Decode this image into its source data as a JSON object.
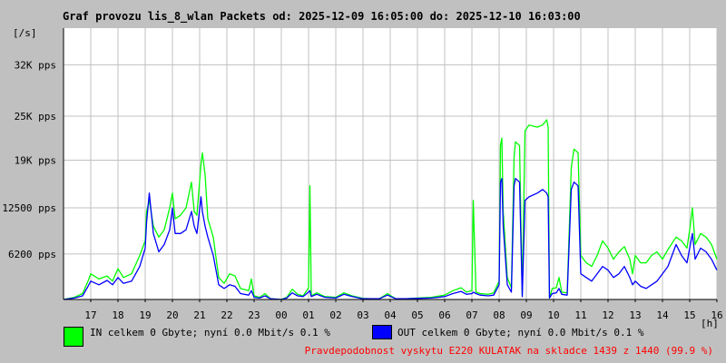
{
  "title": "Graf provozu lis_8_wlan Packets od: 2025-12-09 16:05:00 do: 2025-12-10 16:03:00",
  "colors": {
    "in": "#00ff00",
    "out": "#0000ff",
    "footer": "#ff0000",
    "background": "#c0c0c0",
    "plot": "#ffffff",
    "grid": "#c0c0c0"
  },
  "legend": {
    "in_text": "IN celkem 0 Gbyte; nyní   0.0 Mbit/s 0.1 %",
    "out_text": "OUT celkem 0 Gbyte; nyní   0.0 Mbit/s 0.1 %"
  },
  "footer_text": "Pravdepodobnost vyskytu E220 KULATAK na skladce 1439 z 1440 (99.9 %)",
  "chart_data": {
    "type": "line",
    "title": "Graf provozu lis_8_wlan Packets od: 2025-12-09 16:05:00 do: 2025-12-10 16:03:00",
    "ylabel": "[/s]",
    "xlabel": "[h]",
    "x_unit_note": "hours since 2025-12-09 16:05",
    "ylim": [
      0,
      37000
    ],
    "yticks": [
      {
        "value": 6200,
        "label": "6200 pps"
      },
      {
        "value": 12500,
        "label": "12500 pps"
      },
      {
        "value": 19000,
        "label": "19K pps"
      },
      {
        "value": 25000,
        "label": "25K pps"
      },
      {
        "value": 32000,
        "label": "32K pps"
      }
    ],
    "xticks": [
      {
        "hour": 1,
        "label": "17"
      },
      {
        "hour": 2,
        "label": "18"
      },
      {
        "hour": 3,
        "label": "19"
      },
      {
        "hour": 4,
        "label": "20"
      },
      {
        "hour": 5,
        "label": "21"
      },
      {
        "hour": 6,
        "label": "22"
      },
      {
        "hour": 7,
        "label": "23"
      },
      {
        "hour": 8,
        "label": "00"
      },
      {
        "hour": 9,
        "label": "01"
      },
      {
        "hour": 10,
        "label": "02"
      },
      {
        "hour": 11,
        "label": "03"
      },
      {
        "hour": 12,
        "label": "04"
      },
      {
        "hour": 13,
        "label": "05"
      },
      {
        "hour": 14,
        "label": "06"
      },
      {
        "hour": 15,
        "label": "07"
      },
      {
        "hour": 16,
        "label": "08"
      },
      {
        "hour": 17,
        "label": "09"
      },
      {
        "hour": 18,
        "label": "10"
      },
      {
        "hour": 19,
        "label": "11"
      },
      {
        "hour": 20,
        "label": "12"
      },
      {
        "hour": 21,
        "label": "13"
      },
      {
        "hour": 22,
        "label": "14"
      },
      {
        "hour": 23,
        "label": "15"
      },
      {
        "hour": 24,
        "label": "16"
      }
    ],
    "grid": true,
    "series": [
      {
        "name": "IN",
        "color": "#00ff00",
        "points": [
          [
            0,
            0
          ],
          [
            0.4,
            300
          ],
          [
            0.7,
            800
          ],
          [
            0.9,
            2500
          ],
          [
            1.0,
            3500
          ],
          [
            1.3,
            2800
          ],
          [
            1.6,
            3200
          ],
          [
            1.8,
            2500
          ],
          [
            2.0,
            4200
          ],
          [
            2.2,
            3000
          ],
          [
            2.5,
            3500
          ],
          [
            2.8,
            6000
          ],
          [
            3.0,
            8000
          ],
          [
            3.05,
            12000
          ],
          [
            3.15,
            13500
          ],
          [
            3.3,
            10000
          ],
          [
            3.5,
            8500
          ],
          [
            3.7,
            9500
          ],
          [
            3.9,
            12500
          ],
          [
            4.0,
            14500
          ],
          [
            4.1,
            11000
          ],
          [
            4.3,
            11500
          ],
          [
            4.5,
            12500
          ],
          [
            4.7,
            16000
          ],
          [
            4.8,
            12000
          ],
          [
            4.9,
            11500
          ],
          [
            5.05,
            18500
          ],
          [
            5.1,
            20000
          ],
          [
            5.2,
            17000
          ],
          [
            5.3,
            11000
          ],
          [
            5.5,
            8500
          ],
          [
            5.7,
            3000
          ],
          [
            5.9,
            2200
          ],
          [
            6.1,
            3500
          ],
          [
            6.3,
            3200
          ],
          [
            6.5,
            1500
          ],
          [
            6.8,
            1200
          ],
          [
            6.9,
            2800
          ],
          [
            7.0,
            500
          ],
          [
            7.2,
            300
          ],
          [
            7.4,
            800
          ],
          [
            7.6,
            100
          ],
          [
            8.0,
            0
          ],
          [
            8.2,
            300
          ],
          [
            8.4,
            1400
          ],
          [
            8.6,
            700
          ],
          [
            8.8,
            500
          ],
          [
            9.0,
            1600
          ],
          [
            9.05,
            15500
          ],
          [
            9.1,
            500
          ],
          [
            9.3,
            900
          ],
          [
            9.6,
            400
          ],
          [
            10.0,
            300
          ],
          [
            10.3,
            900
          ],
          [
            10.6,
            500
          ],
          [
            11.0,
            150
          ],
          [
            11.3,
            100
          ],
          [
            11.6,
            100
          ],
          [
            11.9,
            800
          ],
          [
            12.2,
            100
          ],
          [
            12.6,
            100
          ],
          [
            13.0,
            200
          ],
          [
            13.5,
            300
          ],
          [
            14.0,
            600
          ],
          [
            14.3,
            1200
          ],
          [
            14.6,
            1600
          ],
          [
            14.8,
            1000
          ],
          [
            15.0,
            1200
          ],
          [
            15.05,
            13500
          ],
          [
            15.15,
            1000
          ],
          [
            15.3,
            800
          ],
          [
            15.6,
            700
          ],
          [
            15.8,
            900
          ],
          [
            16.0,
            2500
          ],
          [
            16.05,
            21000
          ],
          [
            16.1,
            22000
          ],
          [
            16.15,
            12000
          ],
          [
            16.3,
            3000
          ],
          [
            16.45,
            1600
          ],
          [
            16.55,
            19500
          ],
          [
            16.6,
            21500
          ],
          [
            16.75,
            21000
          ],
          [
            16.85,
            600
          ],
          [
            16.95,
            23000
          ],
          [
            17.1,
            23800
          ],
          [
            17.4,
            23500
          ],
          [
            17.6,
            23800
          ],
          [
            17.75,
            24500
          ],
          [
            17.8,
            23500
          ],
          [
            17.85,
            200
          ],
          [
            17.95,
            1500
          ],
          [
            18.1,
            1600
          ],
          [
            18.2,
            3000
          ],
          [
            18.3,
            1000
          ],
          [
            18.5,
            900
          ],
          [
            18.65,
            18000
          ],
          [
            18.75,
            20500
          ],
          [
            18.9,
            20000
          ],
          [
            19.0,
            6000
          ],
          [
            19.2,
            5000
          ],
          [
            19.4,
            4500
          ],
          [
            19.6,
            6000
          ],
          [
            19.8,
            8000
          ],
          [
            20.0,
            7000
          ],
          [
            20.2,
            5500
          ],
          [
            20.4,
            6500
          ],
          [
            20.6,
            7200
          ],
          [
            20.8,
            5500
          ],
          [
            20.9,
            3500
          ],
          [
            21.0,
            6000
          ],
          [
            21.2,
            5000
          ],
          [
            21.4,
            5000
          ],
          [
            21.6,
            6000
          ],
          [
            21.8,
            6500
          ],
          [
            22.0,
            5500
          ],
          [
            22.2,
            6800
          ],
          [
            22.5,
            8500
          ],
          [
            22.7,
            8000
          ],
          [
            22.9,
            7000
          ],
          [
            23.0,
            9500
          ],
          [
            23.1,
            12500
          ],
          [
            23.2,
            7500
          ],
          [
            23.4,
            9000
          ],
          [
            23.6,
            8500
          ],
          [
            23.8,
            7500
          ],
          [
            24.0,
            5500
          ]
        ]
      },
      {
        "name": "OUT",
        "color": "#0000ff",
        "points": [
          [
            0,
            0
          ],
          [
            0.4,
            200
          ],
          [
            0.7,
            500
          ],
          [
            0.9,
            1800
          ],
          [
            1.0,
            2500
          ],
          [
            1.3,
            2000
          ],
          [
            1.6,
            2600
          ],
          [
            1.8,
            2000
          ],
          [
            2.0,
            3000
          ],
          [
            2.2,
            2200
          ],
          [
            2.5,
            2500
          ],
          [
            2.8,
            4500
          ],
          [
            3.0,
            7000
          ],
          [
            3.05,
            10500
          ],
          [
            3.15,
            14500
          ],
          [
            3.3,
            9000
          ],
          [
            3.5,
            6500
          ],
          [
            3.7,
            7500
          ],
          [
            3.9,
            9500
          ],
          [
            4.0,
            12500
          ],
          [
            4.1,
            9000
          ],
          [
            4.3,
            9000
          ],
          [
            4.5,
            9500
          ],
          [
            4.7,
            12000
          ],
          [
            4.8,
            10000
          ],
          [
            4.9,
            9000
          ],
          [
            5.05,
            14000
          ],
          [
            5.1,
            12000
          ],
          [
            5.2,
            10000
          ],
          [
            5.3,
            8500
          ],
          [
            5.5,
            6000
          ],
          [
            5.7,
            2000
          ],
          [
            5.9,
            1500
          ],
          [
            6.1,
            2000
          ],
          [
            6.3,
            1800
          ],
          [
            6.5,
            800
          ],
          [
            6.8,
            600
          ],
          [
            6.9,
            1200
          ],
          [
            7.0,
            300
          ],
          [
            7.2,
            200
          ],
          [
            7.4,
            500
          ],
          [
            7.6,
            100
          ],
          [
            8.0,
            0
          ],
          [
            8.2,
            200
          ],
          [
            8.4,
            900
          ],
          [
            8.6,
            500
          ],
          [
            8.8,
            400
          ],
          [
            9.0,
            1000
          ],
          [
            9.05,
            1200
          ],
          [
            9.1,
            400
          ],
          [
            9.3,
            700
          ],
          [
            9.6,
            300
          ],
          [
            10.0,
            200
          ],
          [
            10.3,
            700
          ],
          [
            10.6,
            400
          ],
          [
            11.0,
            100
          ],
          [
            11.3,
            100
          ],
          [
            11.6,
            100
          ],
          [
            11.9,
            600
          ],
          [
            12.2,
            100
          ],
          [
            12.6,
            100
          ],
          [
            13.0,
            150
          ],
          [
            13.5,
            200
          ],
          [
            14.0,
            400
          ],
          [
            14.3,
            800
          ],
          [
            14.6,
            1100
          ],
          [
            14.8,
            700
          ],
          [
            15.0,
            800
          ],
          [
            15.05,
            1000
          ],
          [
            15.15,
            800
          ],
          [
            15.3,
            600
          ],
          [
            15.6,
            500
          ],
          [
            15.8,
            600
          ],
          [
            16.0,
            2000
          ],
          [
            16.05,
            16000
          ],
          [
            16.1,
            16500
          ],
          [
            16.15,
            10000
          ],
          [
            16.3,
            2000
          ],
          [
            16.45,
            1000
          ],
          [
            16.55,
            15500
          ],
          [
            16.6,
            16500
          ],
          [
            16.75,
            16000
          ],
          [
            16.85,
            400
          ],
          [
            16.95,
            13500
          ],
          [
            17.1,
            14000
          ],
          [
            17.4,
            14500
          ],
          [
            17.6,
            15000
          ],
          [
            17.75,
            14500
          ],
          [
            17.8,
            14000
          ],
          [
            17.85,
            200
          ],
          [
            17.95,
            800
          ],
          [
            18.1,
            900
          ],
          [
            18.2,
            1500
          ],
          [
            18.3,
            700
          ],
          [
            18.5,
            600
          ],
          [
            18.65,
            15000
          ],
          [
            18.75,
            16000
          ],
          [
            18.9,
            15500
          ],
          [
            19.0,
            3500
          ],
          [
            19.2,
            3000
          ],
          [
            19.4,
            2500
          ],
          [
            19.6,
            3500
          ],
          [
            19.8,
            4500
          ],
          [
            20.0,
            4000
          ],
          [
            20.2,
            3000
          ],
          [
            20.4,
            3500
          ],
          [
            20.6,
            4500
          ],
          [
            20.8,
            3000
          ],
          [
            20.9,
            2000
          ],
          [
            21.0,
            2500
          ],
          [
            21.2,
            1800
          ],
          [
            21.4,
            1500
          ],
          [
            21.6,
            2000
          ],
          [
            21.8,
            2500
          ],
          [
            22.0,
            3500
          ],
          [
            22.2,
            4500
          ],
          [
            22.5,
            7500
          ],
          [
            22.7,
            6000
          ],
          [
            22.9,
            5000
          ],
          [
            23.0,
            7000
          ],
          [
            23.1,
            9000
          ],
          [
            23.2,
            5500
          ],
          [
            23.4,
            7000
          ],
          [
            23.6,
            6500
          ],
          [
            23.8,
            5500
          ],
          [
            24.0,
            4000
          ]
        ]
      }
    ]
  }
}
